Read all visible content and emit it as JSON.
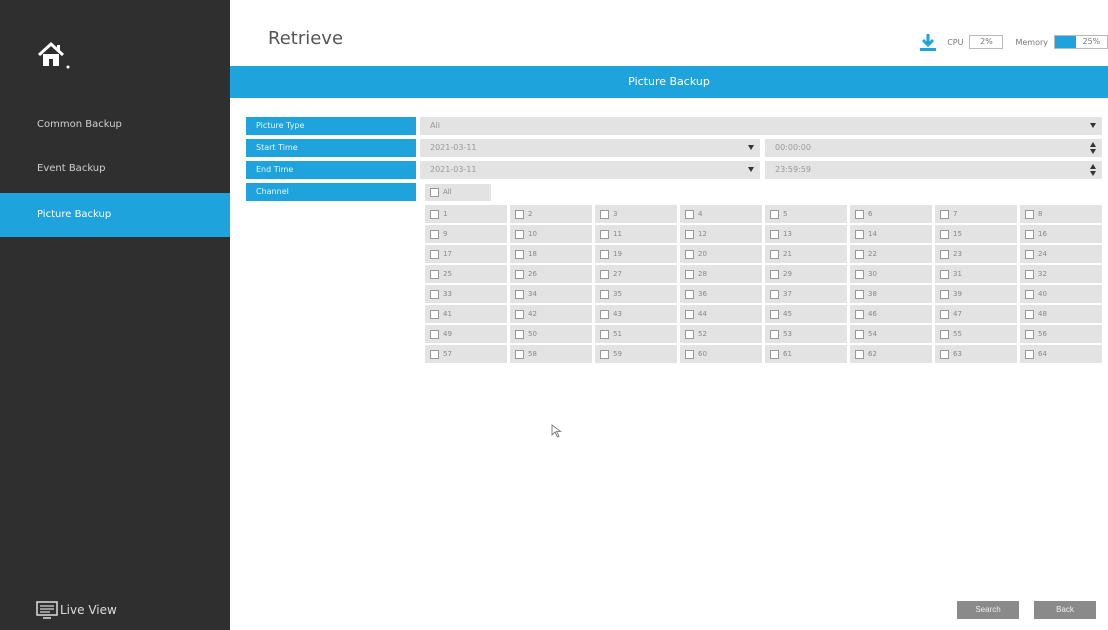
{
  "sidebar": {
    "items": [
      {
        "label": "Common Backup"
      },
      {
        "label": "Event Backup"
      },
      {
        "label": "Picture Backup"
      }
    ],
    "live_view_label": "Live View",
    "home_icon": "home-icon"
  },
  "header": {
    "title": "Retrieve",
    "cpu_label": "CPU",
    "cpu_value": "2%",
    "memory_label": "Memory",
    "memory_value": "25%",
    "memory_level": 0.25
  },
  "section": {
    "title": "Picture Backup"
  },
  "form": {
    "picture_type": {
      "label": "Picture Type",
      "value": "All"
    },
    "start_time": {
      "label": "Start Time",
      "date": "2021-03-11",
      "time": "00:00:00"
    },
    "end_time": {
      "label": "End Time",
      "date": "2021-03-11",
      "time": "23:59:59"
    },
    "channel": {
      "label": "Channel",
      "all_label": "All"
    }
  },
  "channels": [
    "1",
    "2",
    "3",
    "4",
    "5",
    "6",
    "7",
    "8",
    "9",
    "10",
    "11",
    "12",
    "13",
    "14",
    "15",
    "16",
    "17",
    "18",
    "19",
    "20",
    "21",
    "22",
    "23",
    "24",
    "25",
    "26",
    "27",
    "28",
    "29",
    "30",
    "31",
    "32",
    "33",
    "34",
    "35",
    "36",
    "37",
    "38",
    "39",
    "40",
    "41",
    "42",
    "43",
    "44",
    "45",
    "46",
    "47",
    "48",
    "49",
    "50",
    "51",
    "52",
    "53",
    "54",
    "55",
    "56",
    "57",
    "58",
    "59",
    "60",
    "61",
    "62",
    "63",
    "64"
  ],
  "buttons": {
    "search": "Search",
    "back": "Back"
  },
  "colors": {
    "accent": "#1ea3dc",
    "sidebar_bg": "#2f2f2f",
    "button_bg": "#8a8a8a"
  }
}
